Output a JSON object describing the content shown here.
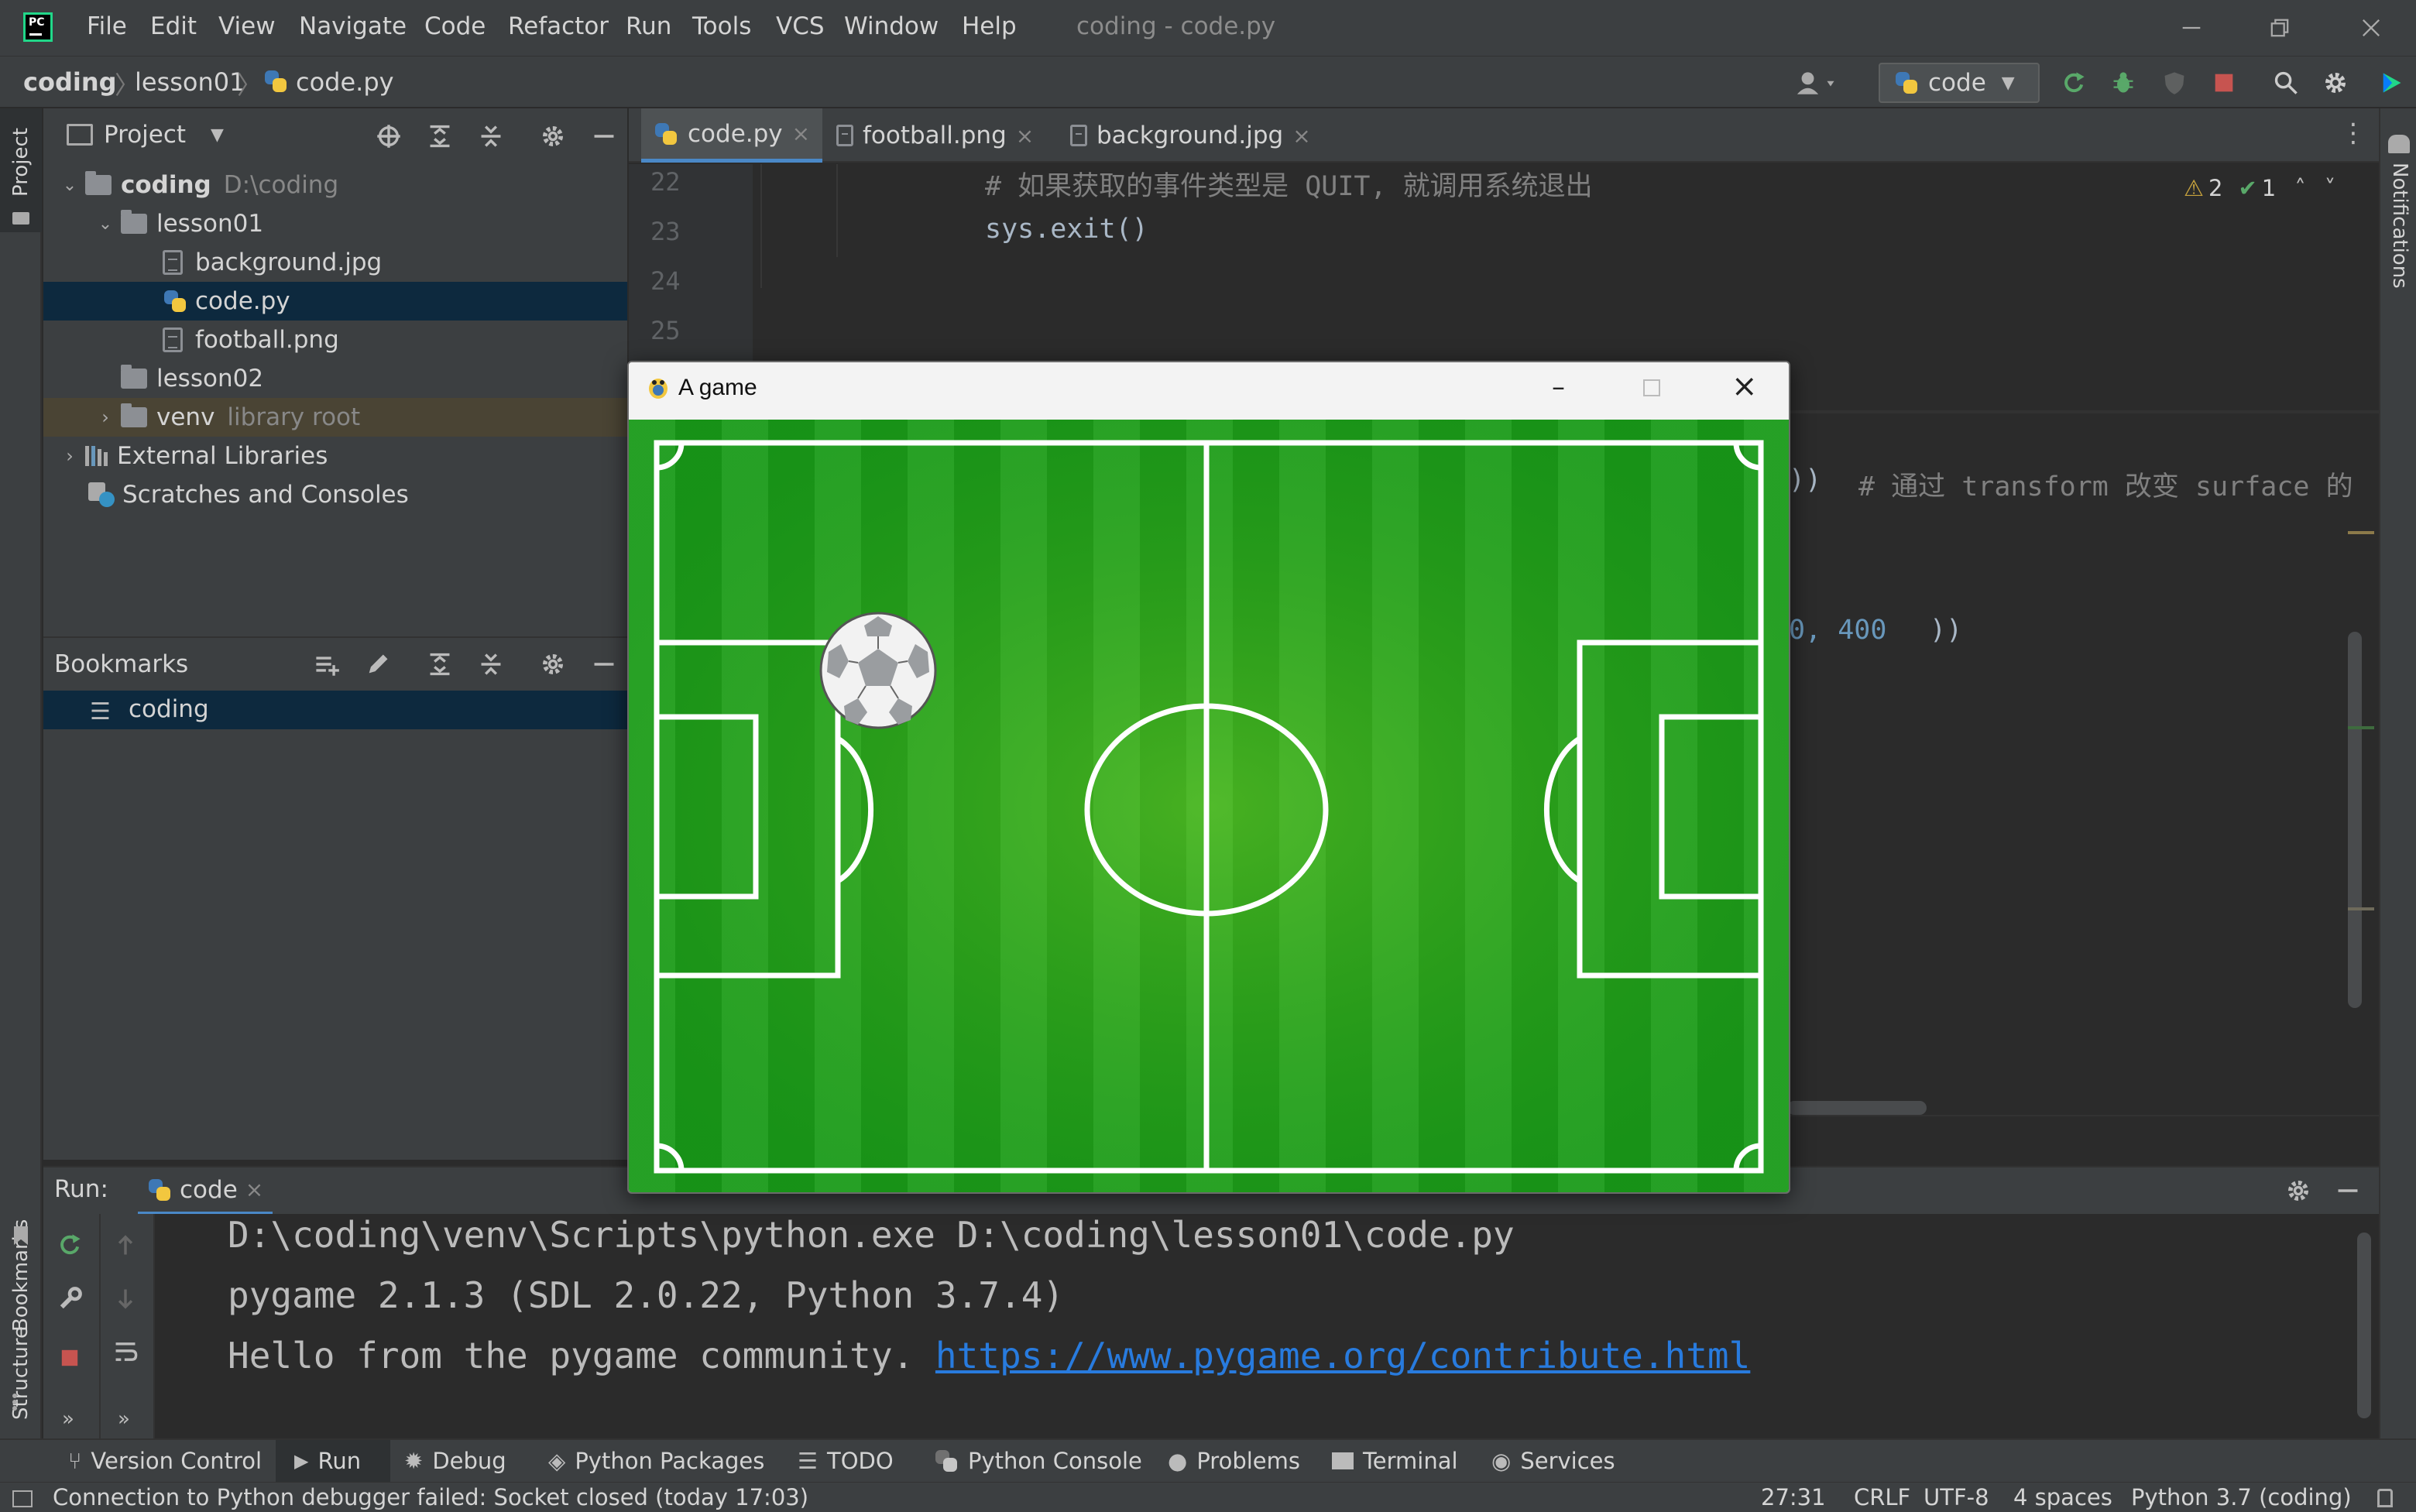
{
  "window": {
    "title": "coding - code.py"
  },
  "menu": [
    "File",
    "Edit",
    "View",
    "Navigate",
    "Code",
    "Refactor",
    "Run",
    "Tools",
    "VCS",
    "Window",
    "Help"
  ],
  "breadcrumb": {
    "project": "coding",
    "folder": "lesson01",
    "file": "code.py"
  },
  "run_config": {
    "label": "code"
  },
  "left_strip": {
    "project_label": "Project",
    "bookmarks_label": "Bookmarks",
    "structure_label": "Structure"
  },
  "right_strip": {
    "notifications_label": "Notifications"
  },
  "project_panel": {
    "title": "Project",
    "tree": {
      "root_name": "coding",
      "root_path": "D:\\coding",
      "lesson01": "lesson01",
      "files": [
        "background.jpg",
        "code.py",
        "football.png"
      ],
      "lesson02": "lesson02",
      "venv": "venv",
      "venv_hint": "library root",
      "external": "External Libraries",
      "scratches": "Scratches and Consoles"
    }
  },
  "bookmarks_panel": {
    "title": "Bookmarks",
    "items": [
      "coding"
    ]
  },
  "editor": {
    "tabs": [
      "code.py",
      "football.png",
      "background.jpg"
    ],
    "active_tab": 0,
    "line_numbers": [
      "22",
      "23",
      "24",
      "25"
    ],
    "lines": [
      {
        "comment": "# 如果获取的事件类型是 QUIT, 就调用系统退出"
      },
      {
        "code": "sys.exit()"
      }
    ],
    "partial_line_1": {
      "code": "))",
      "comment": "# 通过 transform 改变 surface 的"
    },
    "partial_line_2": {
      "num": "0, 400",
      "tail": "))"
    },
    "inspections": {
      "warnings": "2",
      "ok": "1"
    }
  },
  "game_window": {
    "title": "A game"
  },
  "run_panel": {
    "label": "Run:",
    "tab": "code",
    "output": [
      "D:\\coding\\venv\\Scripts\\python.exe D:\\coding\\lesson01\\code.py",
      "pygame 2.1.3 (SDL 2.0.22, Python 3.7.4)"
    ],
    "hello_text": "Hello from the pygame community. ",
    "hello_link": "https://www.pygame.org/contribute.html"
  },
  "bottom_tools": [
    "Version Control",
    "Run",
    "Debug",
    "Python Packages",
    "TODO",
    "Python Console",
    "Problems",
    "Terminal",
    "Services"
  ],
  "status_bar": {
    "message": "Connection to Python debugger failed: Socket closed (today 17:03)",
    "position": "27:31",
    "line_sep": "CRLF",
    "encoding": "UTF-8",
    "indent": "4 spaces",
    "interpreter": "Python 3.7 (coding)"
  },
  "colors": {
    "accent": "#4a88c7",
    "pitch": "#1e9e1e",
    "selection": "#0d293e"
  }
}
